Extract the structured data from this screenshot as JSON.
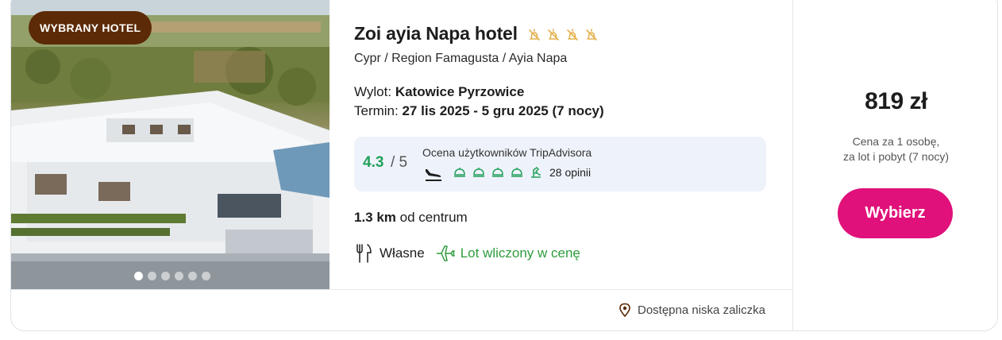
{
  "badge": "WYBRANY HOTEL",
  "hotel": {
    "name": "Zoi ayia Napa hotel",
    "stars": 4,
    "location": "Cypr / Region Famagusta / Ayia Napa"
  },
  "flight": {
    "departure_label": "Wylot:",
    "departure_value": "Katowice Pyrzowice",
    "term_label": "Termin:",
    "term_value": "27 lis 2025 - 5 gru 2025 (7 nocy)"
  },
  "rating": {
    "score": "4.3",
    "max": "/ 5",
    "label": "Ocena użytkowników TripAdvisora",
    "reviews": "28 opinii"
  },
  "distance": {
    "value": "1.3 km",
    "suffix": "od centrum"
  },
  "features": {
    "board": "Własne",
    "flight_included": "Lot wliczony w cenę"
  },
  "deposit": "Dostępna niska zaliczka",
  "price": {
    "amount": "819 zł",
    "note_line1": "Cena za 1 osobę,",
    "note_line2": "za lot i pobyt (7 nocy)"
  },
  "choose_button": "Wybierz",
  "carousel": {
    "count": 6,
    "active": 1
  },
  "colors": {
    "badge_bg": "#5c2a06",
    "star": "#e3b04b",
    "rating_green": "#22a05a",
    "feature_green": "#2f9c3d",
    "button": "#e0117a"
  }
}
